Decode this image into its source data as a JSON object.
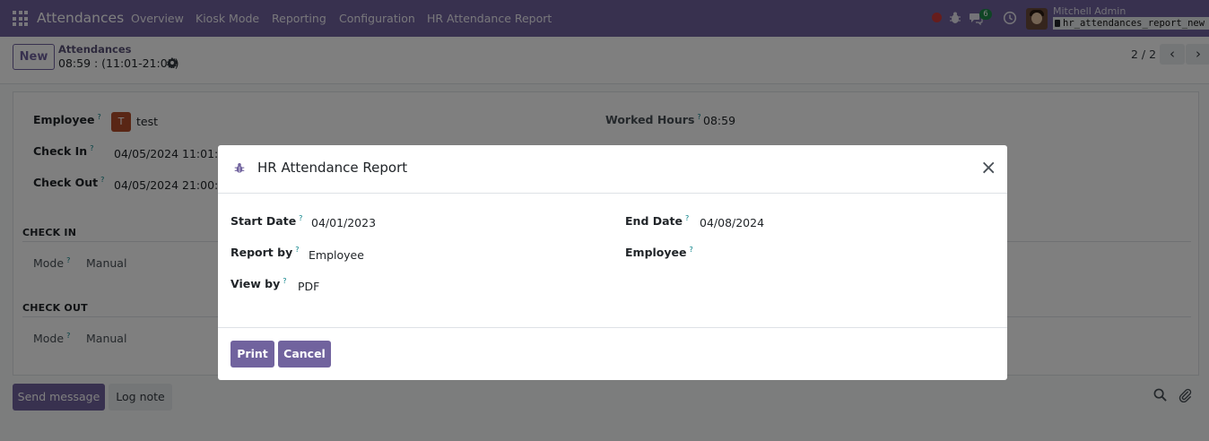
{
  "navbar": {
    "app_name": "Attendances",
    "menu": [
      "Overview",
      "Kiosk Mode",
      "Reporting",
      "Configuration",
      "HR Attendance Report"
    ],
    "chat_count": "6",
    "user_name": "Mitchell Admin",
    "db_name": "hr_attendances_report_new"
  },
  "control_panel": {
    "new_label": "New",
    "breadcrumb_parent": "Attendances",
    "breadcrumb_current": "08:59 : (11:01-21:00)",
    "pager": "2 / 2",
    "prev_glyph": "‹",
    "next_glyph": "›"
  },
  "form": {
    "employee_label": "Employee",
    "employee_initial": "T",
    "employee_value": "test",
    "check_in_label": "Check In",
    "check_in_value": "04/05/2024 11:01:28",
    "check_out_label": "Check Out",
    "check_out_value": "04/05/2024 21:00:00",
    "worked_hours_label": "Worked Hours",
    "worked_hours_value": "08:59",
    "check_in_section": "CHECK IN",
    "check_out_section": "CHECK OUT",
    "mode_label": "Mode",
    "check_in_mode": "Manual",
    "check_out_mode": "Manual",
    "help_mark": "?"
  },
  "chatter": {
    "send_message": "Send message",
    "log_note": "Log note"
  },
  "modal": {
    "title": "HR Attendance Report",
    "start_date_label": "Start Date",
    "start_date_value": "04/01/2023",
    "end_date_label": "End Date",
    "end_date_value": "04/08/2024",
    "report_by_label": "Report by",
    "report_by_value": "Employee",
    "employee_label": "Employee",
    "employee_value": "",
    "view_by_label": "View by",
    "view_by_value": "PDF",
    "print_label": "Print",
    "cancel_label": "Cancel",
    "close_glyph": "×"
  },
  "colors": {
    "brand": "#71639e",
    "help_mark": "#017e84",
    "chat_badge": "#1e8a4b",
    "record_dot": "#cc3b3b"
  }
}
